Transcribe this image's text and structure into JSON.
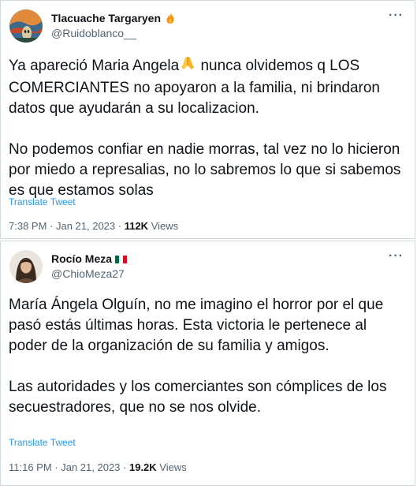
{
  "tweets": [
    {
      "author_name": "Tlacuache Targaryen",
      "handle": "@Ruidoblanco__",
      "name_emoji_icon": "fire-icon",
      "paragraph1_before": "Ya apareció Maria Angela",
      "paragraph1_after": " nunca olvidemos q LOS COMERCIANTES no apoyaron a la familia, ni brindaron datos que ayudarán a su localizacion.",
      "inline_emoji_icon": "folded-hands-icon",
      "paragraph2": "No podemos confiar en nadie morras, tal vez no lo hicieron por miedo a represalias, no lo sabremos lo que si sabemos es que estamos solas",
      "translate": "Translate Tweet",
      "time": "7:38 PM · Jan 21, 2023 · ",
      "views_count": "112K",
      "views_label": " Views"
    },
    {
      "author_name": "Rocío Meza",
      "handle": "@ChioMeza27",
      "name_emoji_icon": "mexico-flag-icon",
      "paragraph1": "María Ángela Olguín, no me imagino el horror por el que pasó estás últimas horas. Esta victoria le pertenece al poder de la organización de su familia y amigos.",
      "paragraph2": "Las autoridades y los comerciantes son cómplices de los secuestradores, que no se nos olvide.",
      "translate": "Translate Tweet",
      "time": "11:16 PM · Jan 21, 2023 · ",
      "views_count": "19.2K",
      "views_label": " Views"
    }
  ],
  "more_label": "···",
  "colors": {
    "link": "#1d9bf0",
    "muted": "#536471",
    "text": "#0f1419",
    "border": "#cfd9de"
  }
}
